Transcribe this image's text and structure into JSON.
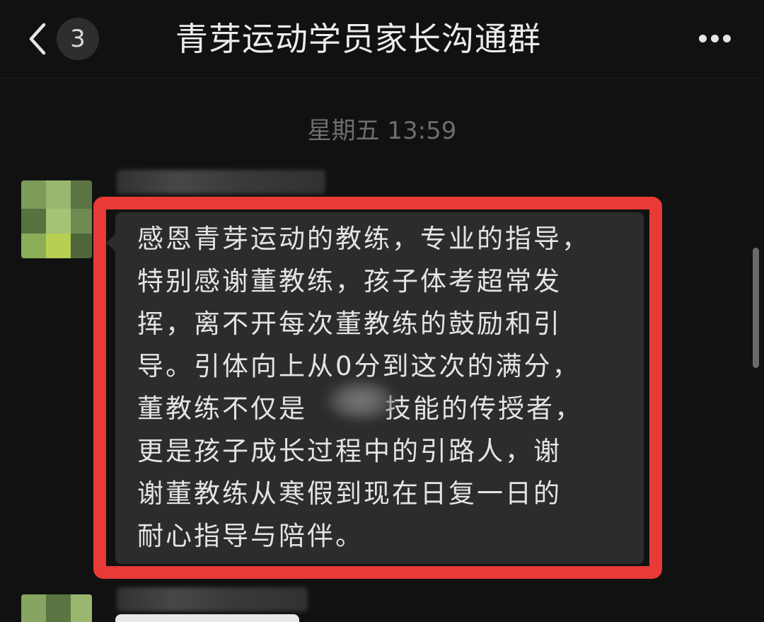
{
  "header": {
    "back_icon": "chevron-left-icon",
    "unread_count": "3",
    "title": "青芽运动学员家长沟通群",
    "more_icon": "more-dots-icon"
  },
  "chat": {
    "timestamp": "星期五 13:59",
    "message": {
      "lines": [
        "感恩青芽运动的教练，专业的指导，",
        "特别感谢董教练，孩子体考超常发",
        "挥，离不开每次董教练的鼓励和引",
        "导。引体向上从0分到这次的满分，",
        "董教练不仅是",
        "更是孩子成长过程中的引路人，谢",
        "谢董教练从寒假到现在日复一日的",
        "耐心指导与陪伴。"
      ],
      "line5_tail": "技能的传授者，"
    }
  },
  "colors": {
    "background": "#111111",
    "bubble": "#2c2c2c",
    "highlight": "#e83a36",
    "text": "#e4e4e4"
  }
}
